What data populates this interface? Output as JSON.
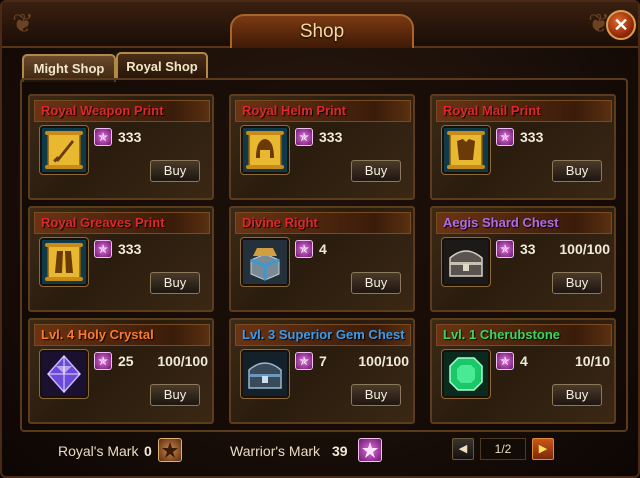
{
  "window": {
    "title": "Shop",
    "close_glyph": "✕"
  },
  "tabs": [
    {
      "label": "Might Shop",
      "active": true
    },
    {
      "label": "Royal Shop",
      "active": false
    }
  ],
  "currency_glyph": "✯",
  "items": [
    {
      "name": "Royal Weapon Print",
      "name_color": "#e0262a",
      "icon": "weapon-scroll-icon",
      "price": "333",
      "stock": "",
      "buy_label": "Buy"
    },
    {
      "name": "Royal Helm Print",
      "name_color": "#e0262a",
      "icon": "helm-scroll-icon",
      "price": "333",
      "stock": "",
      "buy_label": "Buy"
    },
    {
      "name": "Royal Mail Print",
      "name_color": "#e0262a",
      "icon": "mail-scroll-icon",
      "price": "333",
      "stock": "",
      "buy_label": "Buy"
    },
    {
      "name": "Royal Greaves Print",
      "name_color": "#e0262a",
      "icon": "greaves-scroll-icon",
      "price": "333",
      "stock": "",
      "buy_label": "Buy"
    },
    {
      "name": "Divine Right",
      "name_color": "#e0262a",
      "icon": "divine-right-box-icon",
      "price": "4",
      "stock": "",
      "buy_label": "Buy"
    },
    {
      "name": "Aegis Shard Chest",
      "name_color": "#b36ae8",
      "icon": "aegis-chest-icon",
      "price": "33",
      "stock": "100/100",
      "buy_label": "Buy"
    },
    {
      "name": "Lvl. 4 Holy Crystal",
      "name_color": "#ff7a2a",
      "icon": "holy-crystal-icon",
      "price": "25",
      "stock": "100/100",
      "buy_label": "Buy"
    },
    {
      "name": "Lvl. 3 Superior Gem Chest",
      "name_color": "#3a9cf0",
      "icon": "gem-chest-icon",
      "price": "7",
      "stock": "100/100",
      "buy_label": "Buy"
    },
    {
      "name": "Lvl. 1 Cherubstone",
      "name_color": "#3ad85a",
      "icon": "cherubstone-icon",
      "price": "4",
      "stock": "10/10",
      "buy_label": "Buy"
    }
  ],
  "footer": {
    "royals_mark_label": "Royal's Mark",
    "royals_mark_value": "0",
    "warriors_mark_label": "Warrior's Mark",
    "warriors_mark_value": "39",
    "pager": {
      "prev_glyph": "◀",
      "next_glyph": "▶",
      "page_label": "1/2"
    }
  }
}
